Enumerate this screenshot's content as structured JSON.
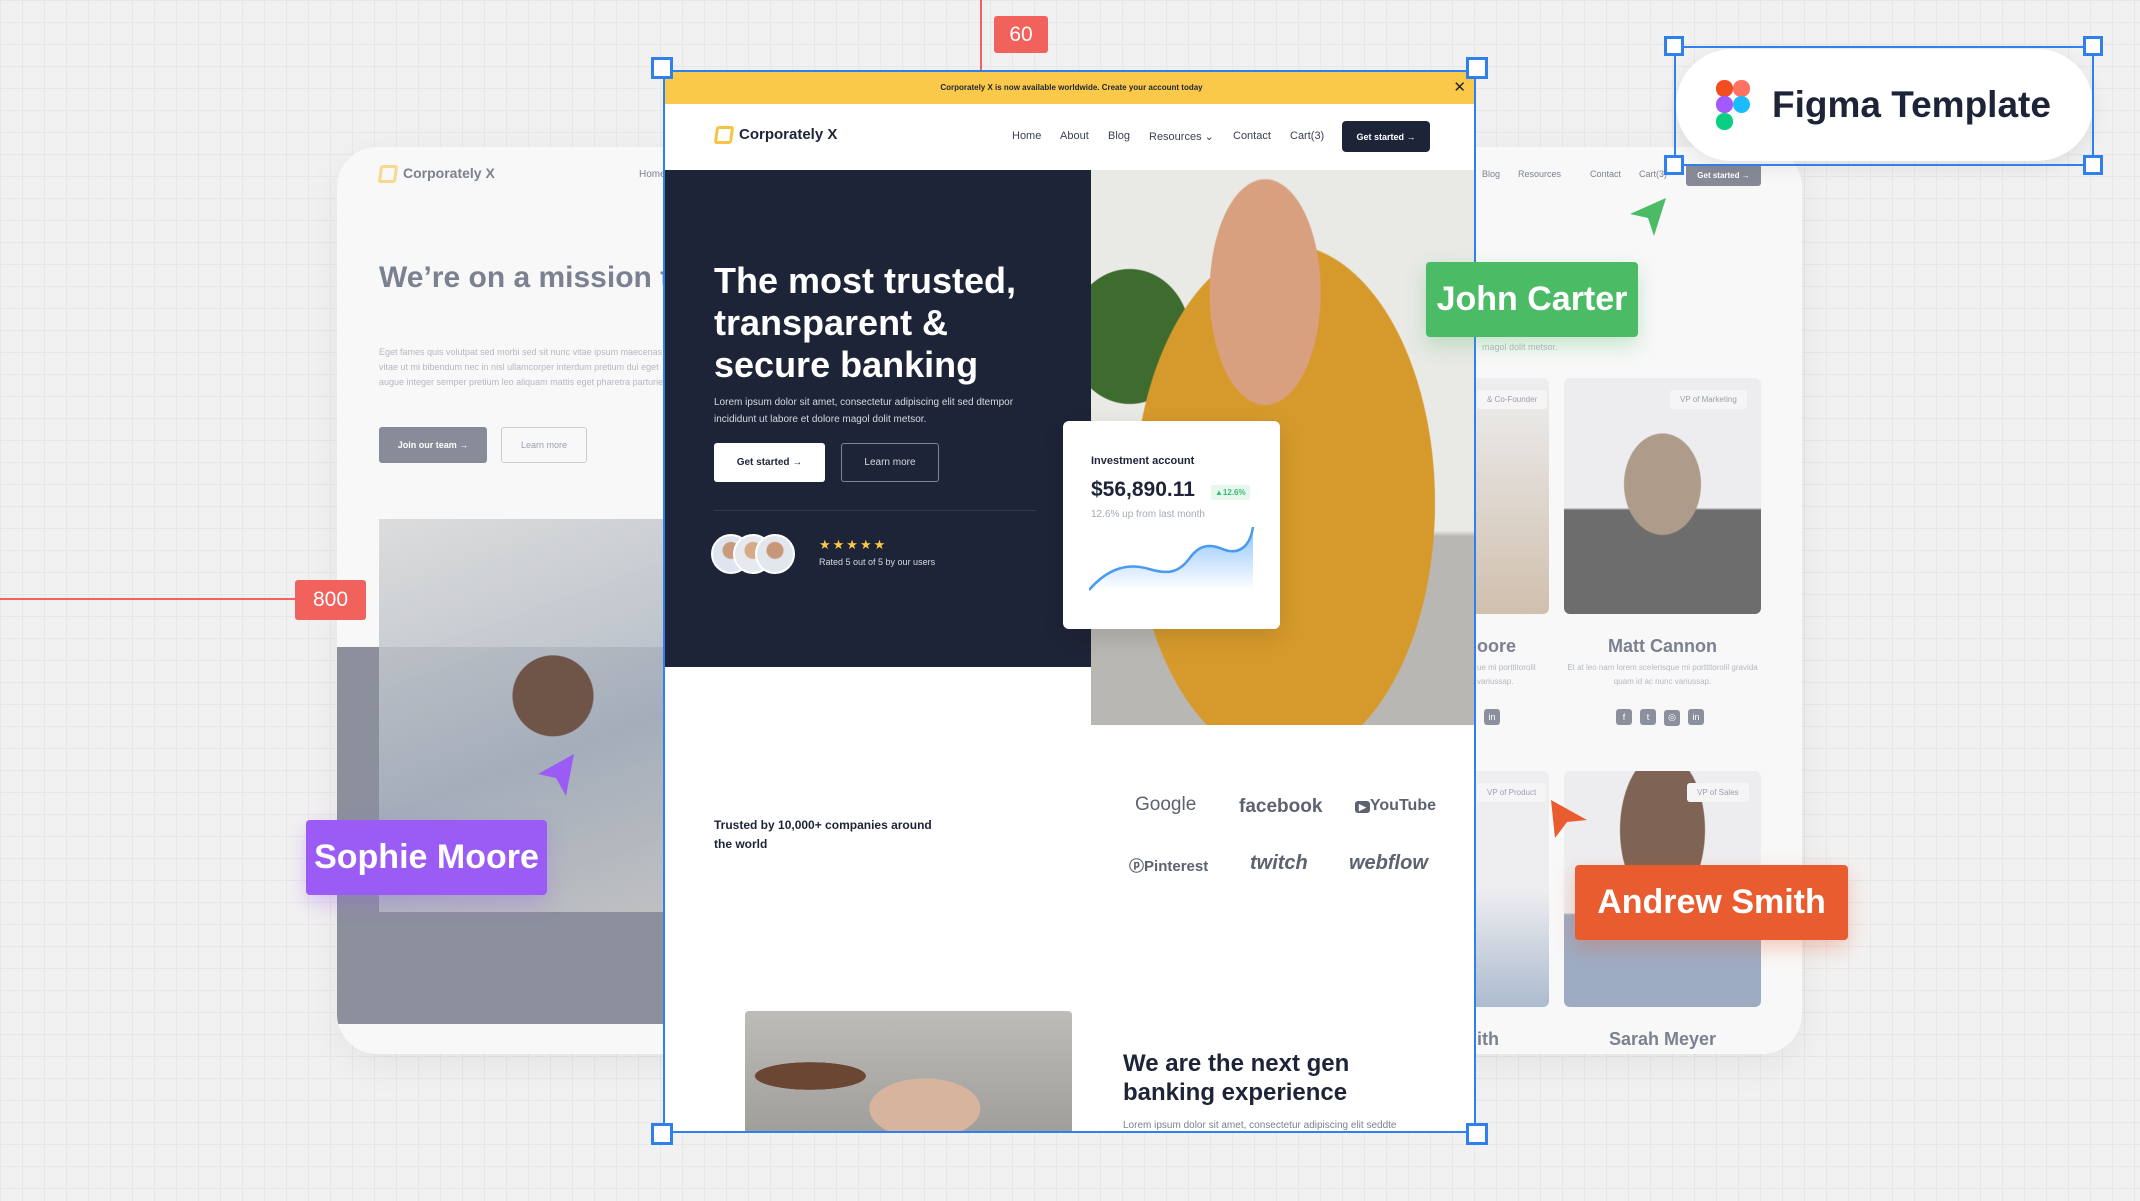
{
  "measure": {
    "top_gap": "60",
    "left_gap": "800"
  },
  "figma_pill": {
    "label": "Figma Template"
  },
  "cursors": {
    "john": "John Carter",
    "sophie": "Sophie Moore",
    "andrew": "Andrew Smith",
    "colors": {
      "john": "#4cbb65",
      "sophie": "#9b5cf6",
      "andrew": "#e95c2f"
    }
  },
  "back_page": {
    "brand": "Corporately X",
    "nav_home": "Home",
    "nav": [
      "Blog",
      "Resources",
      "Contact",
      "Cart(3)"
    ],
    "get_started": "Get started →",
    "heading": "We’re on a mission to empower investors",
    "paragraph": "Eget fames quis volutpat sed morbi sed sit nunc vitae ipsum maecenas vitae ut mi bibendum nec in nisl ullamcorper interdum pretium dui eget augue integer semper pretium leo aliquam mattis eget pharetra parturient.",
    "join_team": "Join our team →",
    "learn_more": "Learn more",
    "team_sub": "magol dolit metsor.",
    "team": [
      {
        "role": "& Co-Founder",
        "name": "oore",
        "desc": "ue mi porttitorolil variussap."
      },
      {
        "role": "VP of Marketing",
        "name": "Matt Cannon",
        "desc": "Et at leo nam lorem scelerisque mi porttitorolil gravida quam id ac nunc variussap."
      },
      {
        "role": "VP of Product",
        "name": "ith"
      },
      {
        "role": "VP of Sales",
        "name": "Sarah Meyer"
      }
    ]
  },
  "page": {
    "banner": "Corporately X is now available worldwide. Create your account today",
    "brand": "Corporately X",
    "nav": [
      "Home",
      "About",
      "Blog",
      "Resources",
      "Contact",
      "Cart(3)"
    ],
    "get_started": "Get started →",
    "hero_title": "The most trusted, transparent & secure banking",
    "hero_text": "Lorem ipsum dolor sit amet, consectetur adipiscing elit sed dtempor incididunt ut labore et dolore magol dolit metsor.",
    "cta_primary": "Get started →",
    "cta_secondary": "Learn more",
    "stars": "★★★★★",
    "rating": "Rated 5 out of 5 by our users",
    "investment": {
      "title": "Investment account",
      "amount": "$56,890.11",
      "change": "▲12.6%",
      "sub": "12.6% up from last month"
    },
    "trusted": "Trusted by 10,000+ companies around the world",
    "logos": [
      "Google",
      "facebook",
      "YouTube",
      "Pinterest",
      "twitch",
      "webflow"
    ],
    "section_title": "We are the next gen banking experience",
    "section_text": "Lorem ipsum dolor sit amet, consectetur adipiscing elit seddte"
  }
}
